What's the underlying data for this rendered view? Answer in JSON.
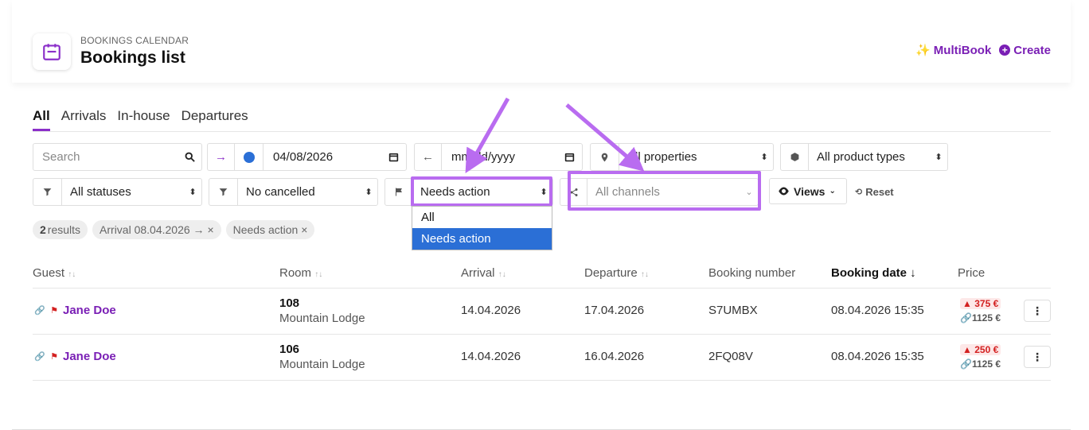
{
  "header": {
    "breadcrumb": "BOOKINGS CALENDAR",
    "title": "Bookings list",
    "multibook_label": "MultiBook",
    "create_label": "Create"
  },
  "tabs": [
    {
      "label": "All",
      "active": true
    },
    {
      "label": "Arrivals",
      "active": false
    },
    {
      "label": "In-house",
      "active": false
    },
    {
      "label": "Departures",
      "active": false
    }
  ],
  "filters": {
    "search_placeholder": "Search",
    "arrival_date": "04/08/2026",
    "departure_date_placeholder": "mm/dd/yyyy",
    "property": "All properties",
    "product_type": "All product types",
    "status": "All statuses",
    "cancelled": "No cancelled",
    "action": "Needs action",
    "channels_placeholder": "All channels",
    "views_label": "Views",
    "reset_label": "Reset"
  },
  "action_dropdown": {
    "options": [
      "All",
      "Needs action"
    ],
    "selected": "Needs action"
  },
  "chips": {
    "results_count": "2",
    "results_label": "results",
    "arrival_chip": "Arrival 08.04.2026 → ×",
    "action_chip": "Needs action ×"
  },
  "table": {
    "headers": {
      "guest": "Guest",
      "room": "Room",
      "arrival": "Arrival",
      "departure": "Departure",
      "booking_number": "Booking number",
      "booking_date": "Booking date ↓",
      "price": "Price"
    },
    "rows": [
      {
        "guest": "Jane Doe",
        "room_number": "108",
        "room_name": "Mountain Lodge",
        "arrival": "14.04.2026",
        "departure": "17.04.2026",
        "booking_number": "S7UMBX",
        "booking_date": "08.04.2026 15:35",
        "price_due": "375 €",
        "price_total": "1125 €"
      },
      {
        "guest": "Jane Doe",
        "room_number": "106",
        "room_name": "Mountain Lodge",
        "arrival": "14.04.2026",
        "departure": "16.04.2026",
        "booking_number": "2FQ08V",
        "booking_date": "08.04.2026 15:35",
        "price_due": "250 €",
        "price_total": "1125 €"
      }
    ]
  },
  "colors": {
    "accent": "#7a1fb5",
    "highlight": "#b96cf0",
    "selected_option": "#2b6fd6",
    "due": "#d32020"
  }
}
